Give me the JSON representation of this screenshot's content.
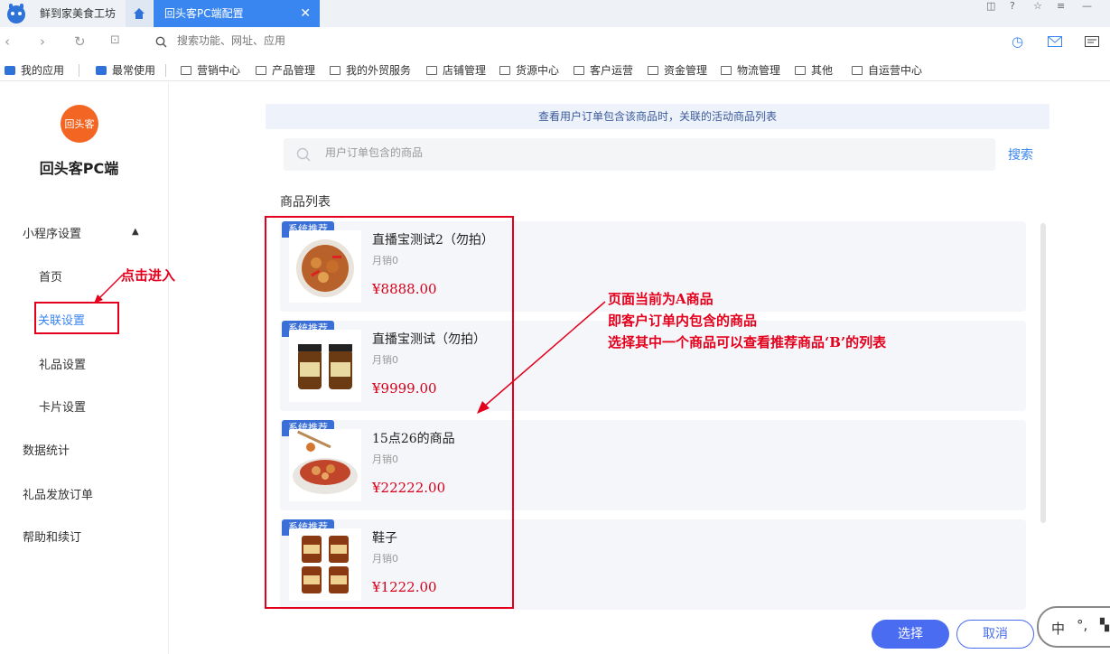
{
  "browser": {
    "tabs": [
      {
        "label": "鲜到家美食工坊"
      },
      {
        "label": "回头客PC端配置",
        "active": true
      }
    ],
    "address_placeholder": "搜索功能、网址、应用",
    "bookmarks": [
      {
        "label": "我的应用"
      },
      {
        "label": "最常使用"
      },
      {
        "label": "营销中心"
      },
      {
        "label": "产品管理"
      },
      {
        "label": "我的外贸服务"
      },
      {
        "label": "店铺管理"
      },
      {
        "label": "货源中心"
      },
      {
        "label": "客户运营"
      },
      {
        "label": "资金管理"
      },
      {
        "label": "物流管理"
      },
      {
        "label": "其他"
      },
      {
        "label": "自运营中心"
      }
    ]
  },
  "sidebar": {
    "logo_text": "回头客",
    "brand_title": "回头客PC端",
    "items": [
      {
        "label": "小程序设置",
        "expanded": true
      },
      {
        "label": "首页"
      },
      {
        "label": "关联设置",
        "active": true
      },
      {
        "label": "礼品设置"
      },
      {
        "label": "卡片设置"
      },
      {
        "label": "数据统计"
      },
      {
        "label": "礼品发放订单"
      },
      {
        "label": "帮助和续订"
      }
    ]
  },
  "annotations": {
    "click_enter": "点击进入",
    "line1": "页面当前为A商品",
    "line2": "即客户订单内包含的商品",
    "line3": "选择其中一个商品可以查看推荐商品‘B’的列表"
  },
  "panel": {
    "header": "查看用户订单包含该商品时，关联的活动商品列表",
    "search_placeholder": "用户订单包含的商品",
    "search_button": "搜索",
    "list_title": "商品列表",
    "products": [
      {
        "badge": "系统推荐",
        "name": "直播宝测试2（勿拍）",
        "sales": "月销0",
        "price": "¥8888.00",
        "image": "braised-chicken-dish"
      },
      {
        "badge": "系统推荐",
        "name": "直播宝测试（勿拍）",
        "sales": "月销0",
        "price": "¥9999.00",
        "image": "sauce-jars"
      },
      {
        "badge": "系统推荐",
        "name": "15点26的商品",
        "sales": "月销0",
        "price": "¥22222.00",
        "image": "chili-chicken-plate"
      },
      {
        "badge": "系统推荐",
        "name": "鞋子",
        "sales": "月销0",
        "price": "¥1222.00",
        "image": "four-sauce-jars"
      }
    ],
    "confirm_button": "选择",
    "cancel_button": "取消"
  },
  "ime": {
    "mode": "中",
    "punct": "°,"
  },
  "colors": {
    "accent": "#3a86f0",
    "annotation": "#e4001d",
    "price": "#d6001c",
    "badge": "#3a6fd8"
  }
}
